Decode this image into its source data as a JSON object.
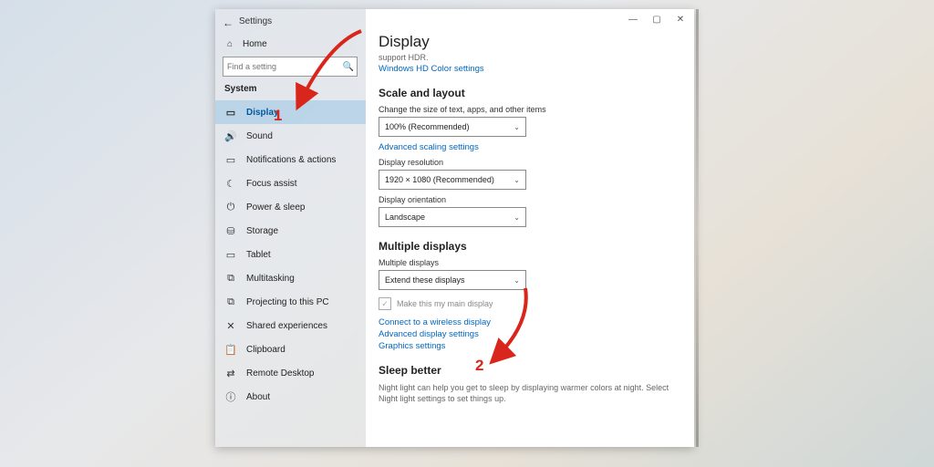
{
  "titlebar": {
    "min": "—",
    "max": "▢",
    "close": "✕"
  },
  "header": {
    "back": "←",
    "app": "Settings"
  },
  "home": {
    "icon": "⌂",
    "label": "Home"
  },
  "search": {
    "placeholder": "Find a setting",
    "icon": "🔍"
  },
  "category": "System",
  "nav": [
    {
      "icon": "▭",
      "label": "Display",
      "selected": true
    },
    {
      "icon": "🔊",
      "label": "Sound"
    },
    {
      "icon": "▭",
      "label": "Notifications & actions"
    },
    {
      "icon": "☾",
      "label": "Focus assist"
    },
    {
      "icon": "⏻",
      "label": "Power & sleep"
    },
    {
      "icon": "⛁",
      "label": "Storage"
    },
    {
      "icon": "▭",
      "label": "Tablet"
    },
    {
      "icon": "⧉",
      "label": "Multitasking"
    },
    {
      "icon": "⧉",
      "label": "Projecting to this PC"
    },
    {
      "icon": "✕",
      "label": "Shared experiences"
    },
    {
      "icon": "📋",
      "label": "Clipboard"
    },
    {
      "icon": "⇄",
      "label": "Remote Desktop"
    },
    {
      "icon": "ⓘ",
      "label": "About"
    }
  ],
  "main": {
    "title": "Display",
    "hdr": "support HDR.",
    "hdr_link": "Windows HD Color settings",
    "scale": {
      "heading": "Scale and layout",
      "size_label": "Change the size of text, apps, and other items",
      "size_value": "100% (Recommended)",
      "adv_link": "Advanced scaling settings",
      "res_label": "Display resolution",
      "res_value": "1920 × 1080 (Recommended)",
      "orient_label": "Display orientation",
      "orient_value": "Landscape"
    },
    "multi": {
      "heading": "Multiple displays",
      "label": "Multiple displays",
      "value": "Extend these displays",
      "main_chk": "Make this my main display",
      "link_wireless": "Connect to a wireless display",
      "link_adv": "Advanced display settings",
      "link_gfx": "Graphics settings"
    },
    "sleep": {
      "heading": "Sleep better",
      "desc": "Night light can help you get to sleep by displaying warmer colors at night. Select Night light settings to set things up."
    }
  },
  "annotations": {
    "one": "1",
    "two": "2"
  }
}
